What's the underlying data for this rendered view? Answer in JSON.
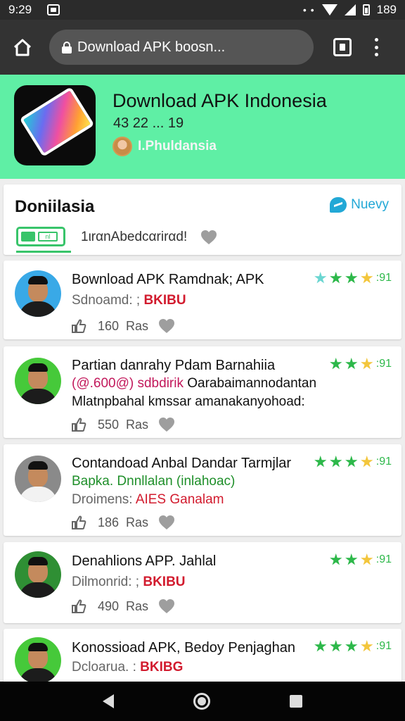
{
  "status_bar": {
    "time": "9:29",
    "dots": "• •",
    "battery": "189"
  },
  "browser": {
    "url": "Download APK boosn..."
  },
  "app": {
    "title": "Download APK Indonesia",
    "meta": "43 22 ... 19",
    "developer": "I.Phuldansia",
    "header_color": "#5fefa5"
  },
  "section": {
    "title": "Doniilasia",
    "link_label": "Nuevy",
    "filter_toggle": "nl",
    "filter_label": "1ιrαnAbedcαrirαd!"
  },
  "items": [
    {
      "title": "Bownload APK Ramdnak; APK",
      "lines": [
        {
          "text": "Sdnoamd: ; ",
          "color": "#666",
          "highlight": "BKIBU",
          "highlight_color": "#d21b2e"
        }
      ],
      "rating": ":91",
      "stars": [
        "#6bd6d1",
        "#2db84a",
        "#2db84a",
        "#f3c63c"
      ],
      "likes": "160",
      "likes_label": "Ras",
      "avatar_bg": "#39a9e7"
    },
    {
      "title": "Partian danrahy Pdam Barnahiia",
      "lines": [
        {
          "text": "(@.600@) sdbdirik ",
          "color": "#c2185b",
          "rest": "Oarabaimannodantan",
          "rest_color": "#111"
        },
        {
          "text": "Mlatnpbahal kmssar amanakanyohoad:",
          "color": "#111"
        }
      ],
      "rating": ":91",
      "stars": [
        "#2db84a",
        "#2db84a",
        "#f3c63c"
      ],
      "likes": "550",
      "likes_label": "Ras",
      "avatar_bg": "#46c93a"
    },
    {
      "title": "Contandoad Anbal Dandar Tarmjlar",
      "lines": [
        {
          "text": "Bapka. Dnnllalan (inlahoac)",
          "color": "#1f8f2a"
        },
        {
          "text": "Droimens: ",
          "color": "#666",
          "highlight": "AIES Ganalam",
          "highlight_color": "#d21b2e"
        }
      ],
      "rating": ":91",
      "stars": [
        "#2db84a",
        "#2db84a",
        "#2db84a",
        "#f3c63c"
      ],
      "likes": "186",
      "likes_label": "Ras",
      "avatar_bg": "#8a8a8a"
    },
    {
      "title": "Denahlions APP. Jahlal",
      "lines": [
        {
          "text": "Dilmonrid: ; ",
          "color": "#666",
          "highlight": "BKIBU",
          "highlight_color": "#d21b2e"
        }
      ],
      "rating": ":91",
      "stars": [
        "#2db84a",
        "#2db84a",
        "#f3c63c"
      ],
      "likes": "490",
      "likes_label": "Ras",
      "avatar_bg": "#2f8f34"
    },
    {
      "title": "Konossioad APK, Bedoy Penjaghan",
      "lines": [
        {
          "text": "Dcloarua. : ",
          "color": "#666",
          "highlight": "BKIBG",
          "highlight_color": "#d21b2e"
        }
      ],
      "rating": ":91",
      "stars": [
        "#2db84a",
        "#2db84a",
        "#2db84a",
        "#f3c63c"
      ],
      "likes": "",
      "likes_label": "",
      "avatar_bg": "#46c93a"
    }
  ]
}
